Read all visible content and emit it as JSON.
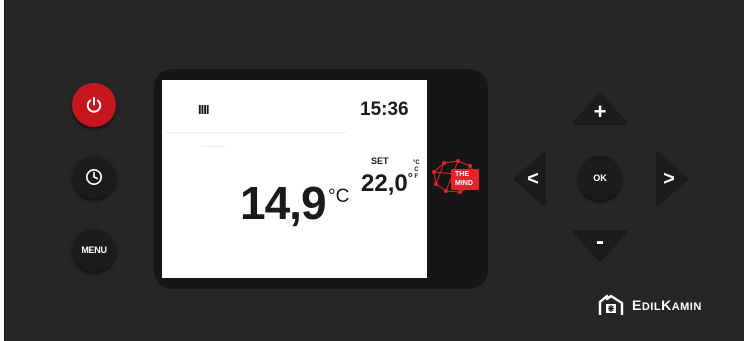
{
  "display": {
    "status_bars": "IIII",
    "time": "15:36",
    "set_label": "SET",
    "unit_options": [
      "°C",
      "C",
      "F"
    ],
    "room_temperature": "14,9",
    "room_temperature_unit": "°C",
    "setpoint": "22,0",
    "setpoint_unit": "°"
  },
  "buttons": {
    "power_icon": "power-icon",
    "clock_icon": "clock-icon",
    "menu_label": "MENU",
    "up_label": "+",
    "down_label": "-",
    "left_label": "<",
    "right_label": ">",
    "ok_label": "OK"
  },
  "logo": {
    "mind_line1": "THE",
    "mind_line2": "MIND",
    "brand_first": "E",
    "brand_mid": "DIL",
    "brand_cap": "K",
    "brand_end": "AMIN"
  },
  "colors": {
    "panel": "#262626",
    "power_red": "#c4161c",
    "mind_red": "#e3242b"
  }
}
